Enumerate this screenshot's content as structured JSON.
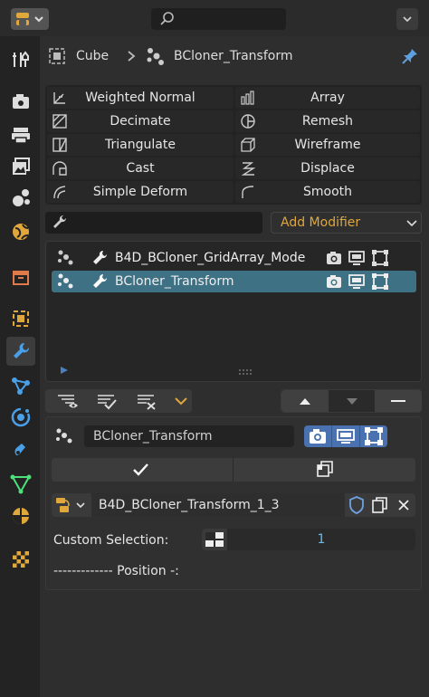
{
  "breadcrumb": {
    "object": "Cube",
    "separator": ">",
    "current": "BCloner_Transform"
  },
  "modifiers": {
    "left": [
      "Weighted Normal",
      "Decimate",
      "Triangulate",
      "Cast",
      "Simple Deform"
    ],
    "right": [
      "Array",
      "Remesh",
      "Wireframe",
      "Displace",
      "Smooth"
    ],
    "add_label": "Add Modifier",
    "search_placeholder": ""
  },
  "stack": {
    "items": [
      {
        "label": "B4D_BCloner_GridArray_Mode",
        "selected": false
      },
      {
        "label": "BCloner_Transform",
        "selected": true
      }
    ]
  },
  "panel": {
    "name": "BCloner_Transform",
    "apply_icon": "checkmark-icon",
    "copy_icon": "duplicate-icon",
    "node_group": "B4D_BCloner_Transform_1_3",
    "custom_selection_label": "Custom Selection:",
    "custom_selection_value": "1",
    "position_header": "------------- Position -:"
  },
  "colors": {
    "accent_orange": "#e0a73a",
    "selected_row": "#3f7185",
    "toggle_blue": "#4a72b0"
  }
}
